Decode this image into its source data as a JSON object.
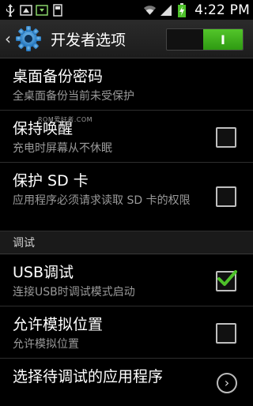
{
  "status": {
    "time": "4:22 PM"
  },
  "header": {
    "back": "‹",
    "title": "开发者选项",
    "toggle_label": "I"
  },
  "watermark": "ROM爱好者.COM",
  "items": [
    {
      "title": "桌面备份密码",
      "subtitle": "全桌面备份当前未受保护"
    },
    {
      "title": "保持唤醒",
      "subtitle": "充电时屏幕从不休眠",
      "checked": false
    },
    {
      "title": "保护 SD 卡",
      "subtitle": "应用程序必须请求读取 SD 卡的权限",
      "checked": false
    }
  ],
  "section": "调试",
  "debug_items": [
    {
      "title": "USB调试",
      "subtitle": "连接USB时调试模式启动",
      "checked": true
    },
    {
      "title": "允许模拟位置",
      "subtitle": "允许模拟位置",
      "checked": false
    },
    {
      "title": "选择待调试的应用程序"
    }
  ],
  "colors": {
    "accent": "#4ec12a",
    "subtitle": "#9a9a9a"
  },
  "icons": [
    "usb-icon",
    "screenshot-icon",
    "download-icon",
    "usb-storage-icon",
    "wifi-icon",
    "signal-icon",
    "battery-icon",
    "gear-icon",
    "chevron-right-icon",
    "checkmark-icon"
  ]
}
